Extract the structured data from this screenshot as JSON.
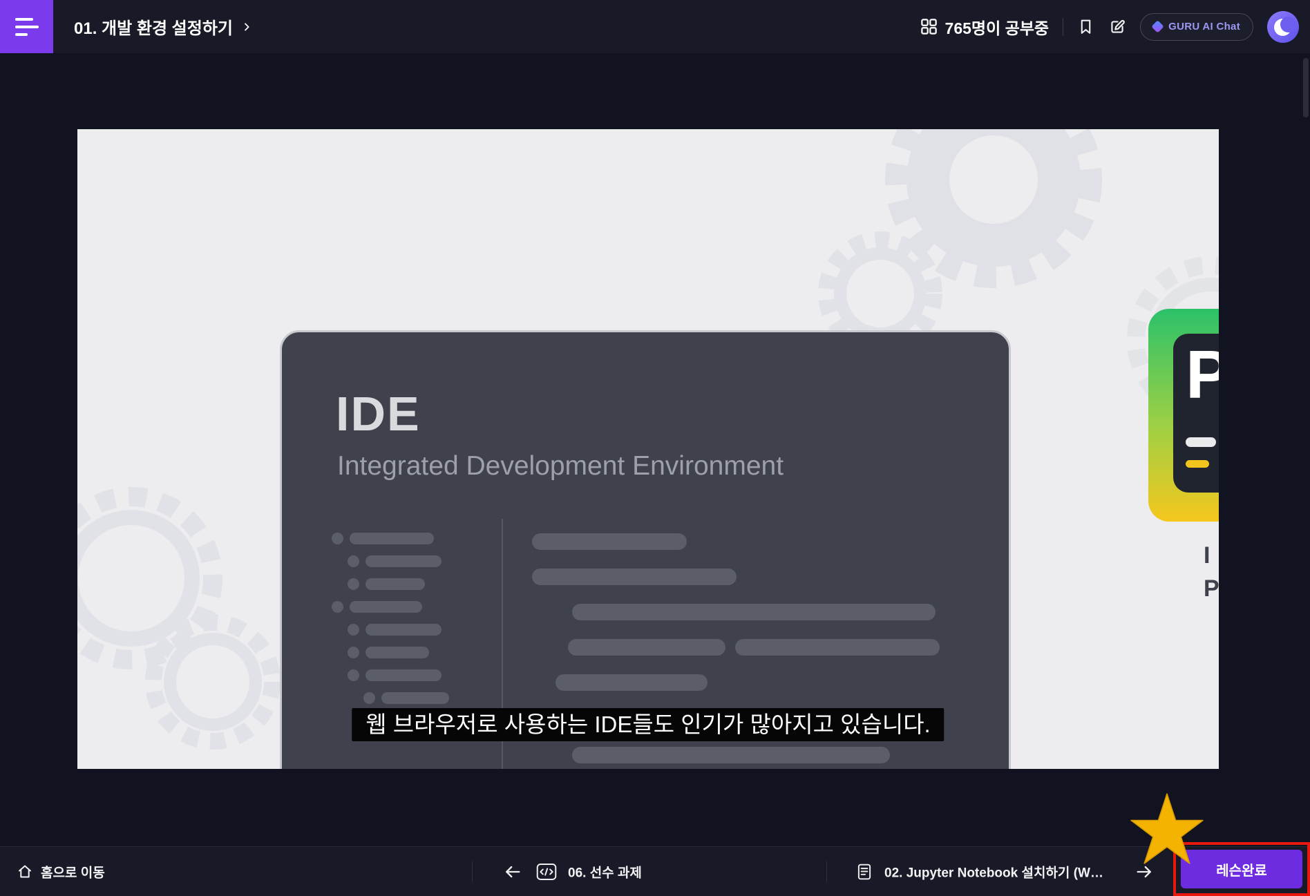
{
  "topbar": {
    "title": "01. 개발 환경 설정하기",
    "studying_label": "765명이 공부중",
    "guru_label": "GURU AI Chat"
  },
  "slide": {
    "heading": "IDE",
    "subheading": "Integrated Development Environment",
    "caption": "웹 브라우저로 사용하는 IDE들도 인기가 많아지고 있습니다.",
    "python_letter": "P",
    "side_line1": "I",
    "side_line2": "Py"
  },
  "bottombar": {
    "home_label": "홈으로 이동",
    "prev_label": "06. 선수 과제",
    "next_label": "02. Jupyter Notebook 설치하기 (W…",
    "complete_label": "레슨완료"
  },
  "icons": [
    "menu-icon",
    "chevron-right-icon",
    "grid-icon",
    "bookmark-icon",
    "compose-icon",
    "diamond-icon",
    "avatar-logo",
    "home-icon",
    "arrow-left-icon",
    "code-chip-icon",
    "document-icon",
    "arrow-right-icon",
    "star-annotation"
  ],
  "colors": {
    "topbar_bg": "#191A27",
    "stage_bg": "#121320",
    "accent_purple": "#7C3AED",
    "complete_button_purple": "#6E2CE0",
    "annotation_red": "#E8180F",
    "annotation_gold": "#F5B301",
    "slide_bg": "#EDEDF0",
    "ide_card_bg": "#3F424C"
  }
}
